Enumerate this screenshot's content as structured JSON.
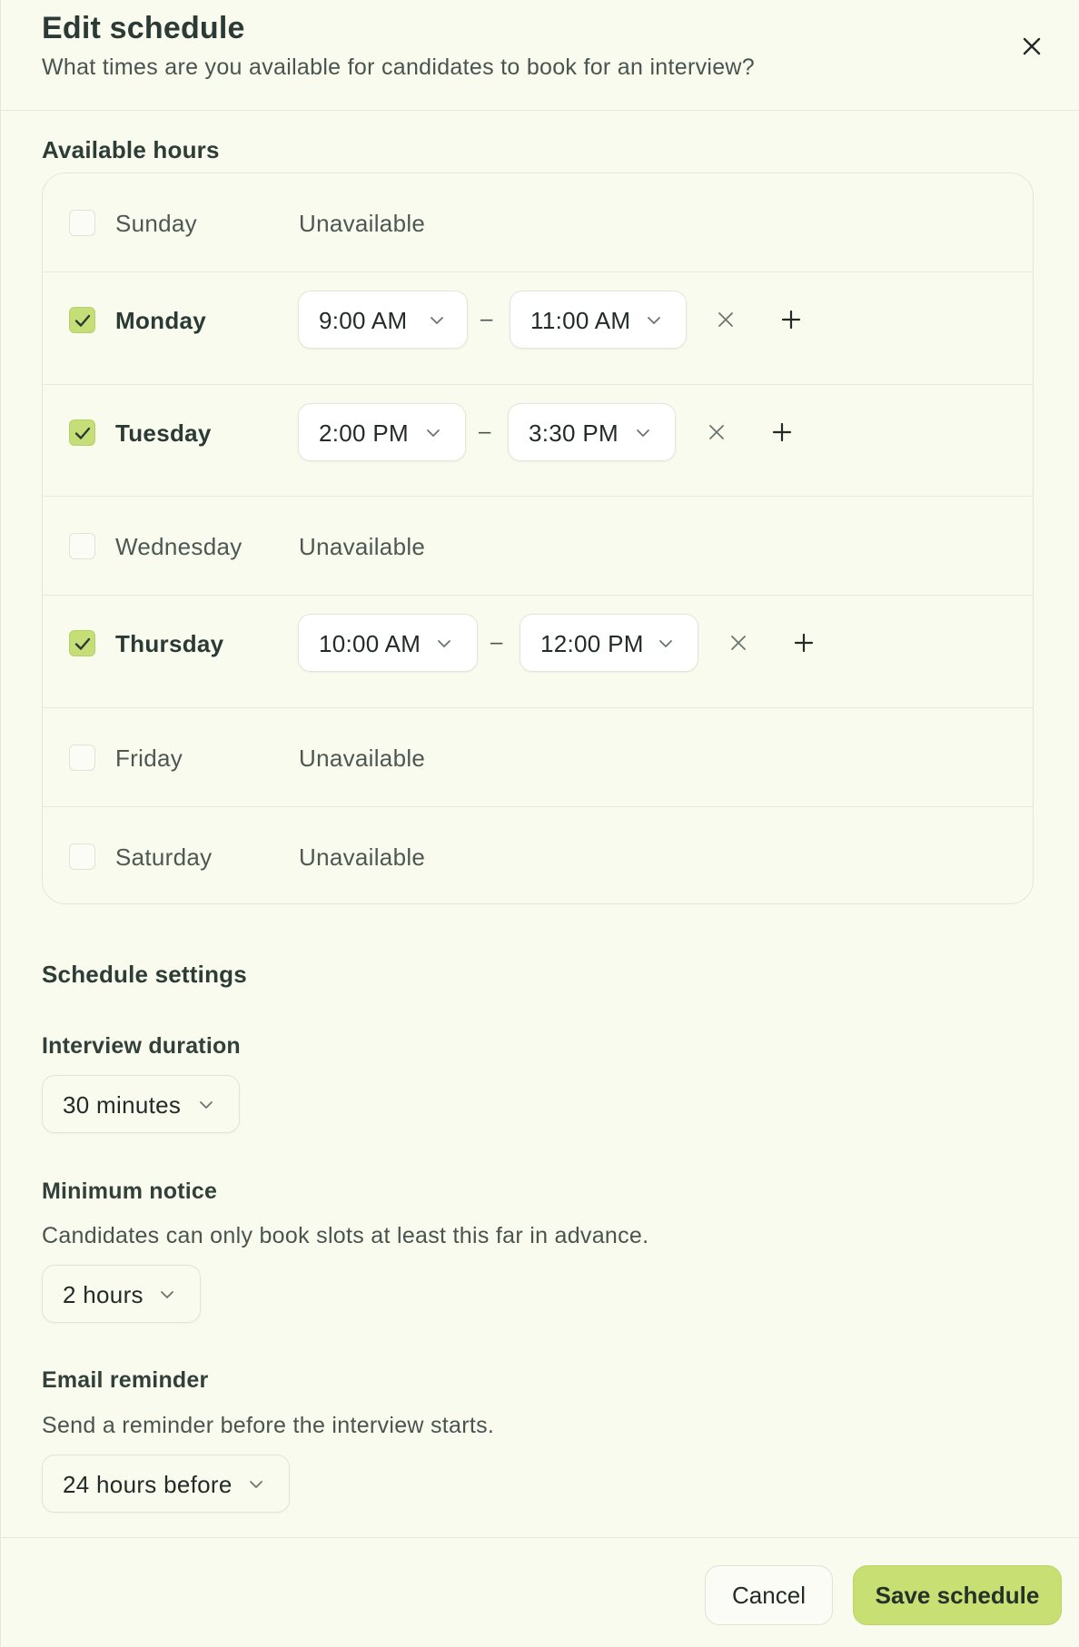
{
  "header": {
    "title": "Edit schedule",
    "subtitle": "What times are you available for candidates to book for an interview?"
  },
  "available_hours": {
    "title": "Available hours",
    "separator": "–",
    "days": [
      {
        "name": "Sunday",
        "checked": false,
        "status": "Unavailable"
      },
      {
        "name": "Monday",
        "checked": true,
        "start": "9:00 AM",
        "end": "11:00 AM"
      },
      {
        "name": "Tuesday",
        "checked": true,
        "start": "2:00 PM",
        "end": "3:30 PM"
      },
      {
        "name": "Wednesday",
        "checked": false,
        "status": "Unavailable"
      },
      {
        "name": "Thursday",
        "checked": true,
        "start": "10:00 AM",
        "end": "12:00 PM"
      },
      {
        "name": "Friday",
        "checked": false,
        "status": "Unavailable"
      },
      {
        "name": "Saturday",
        "checked": false,
        "status": "Unavailable"
      }
    ]
  },
  "schedule_settings": {
    "title": "Schedule settings",
    "interview_duration": {
      "label": "Interview duration",
      "value": "30 minutes"
    },
    "minimum_notice": {
      "label": "Minimum notice",
      "help": "Candidates can only book slots at least this far in advance.",
      "value": "2 hours"
    },
    "email_reminder": {
      "label": "Email reminder",
      "help": "Send a reminder before the interview starts.",
      "value": "24 hours before"
    }
  },
  "footer": {
    "cancel_label": "Cancel",
    "save_label": "Save schedule"
  },
  "colors": {
    "background": "#f9fbef",
    "accent": "#c8df73",
    "text": "#2b3a34"
  },
  "icons": {
    "close": "close-icon",
    "check": "check-icon",
    "chevron": "chevron-down-icon",
    "remove": "remove-slot-icon",
    "add": "add-slot-icon"
  }
}
